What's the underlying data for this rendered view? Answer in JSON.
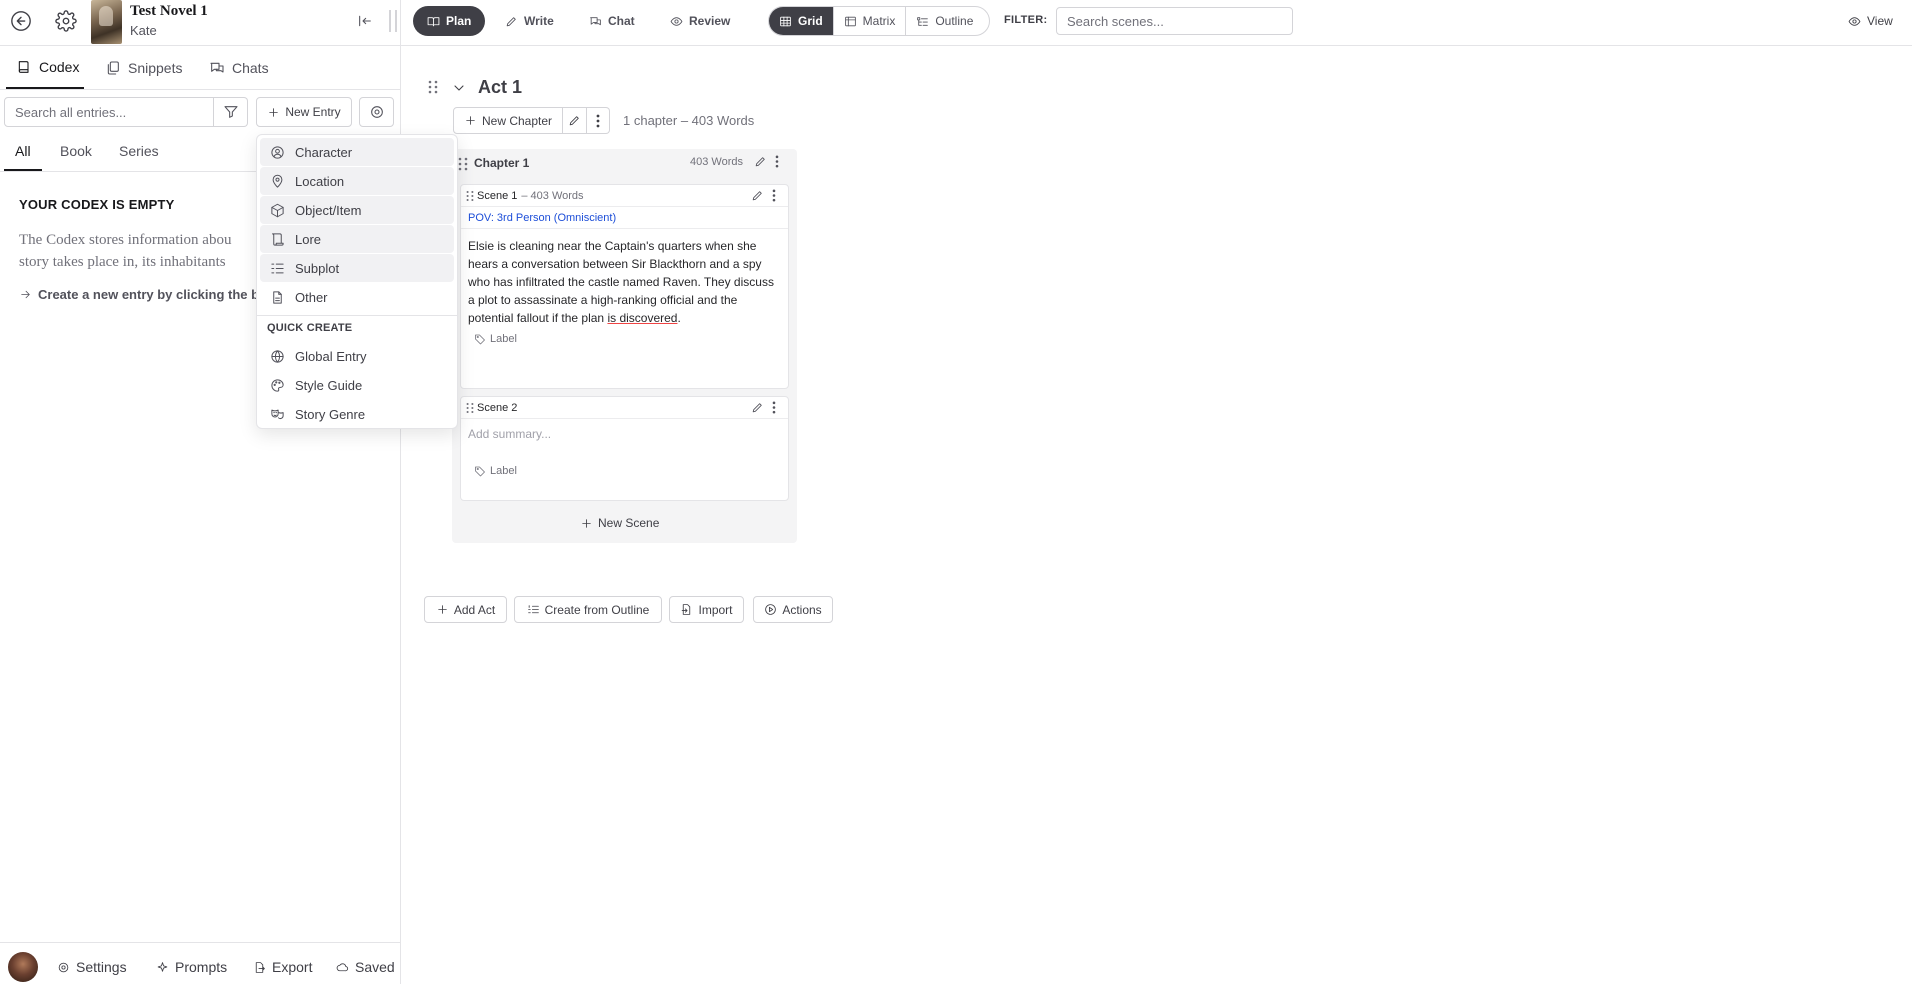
{
  "sidebar": {
    "novel_title": "Test Novel 1",
    "novel_author": "Kate",
    "tabs": [
      {
        "label": "Codex",
        "icon": "book-icon"
      },
      {
        "label": "Snippets",
        "icon": "snippets-icon"
      },
      {
        "label": "Chats",
        "icon": "chats-icon"
      }
    ],
    "search_placeholder": "Search all entries...",
    "new_entry_label": "New Entry",
    "scope_tabs": [
      "All",
      "Book",
      "Series"
    ],
    "empty_title": "YOUR CODEX IS EMPTY",
    "empty_desc": "The Codex stores information abou\nstory takes place in, its inhabitants",
    "empty_hint": "Create a new entry by clicking the bu",
    "footer": {
      "settings": "Settings",
      "prompts": "Prompts",
      "export": "Export",
      "saved": "Saved"
    }
  },
  "dropdown": {
    "items": [
      {
        "label": "Character",
        "icon": "character-icon"
      },
      {
        "label": "Location",
        "icon": "location-pin-icon"
      },
      {
        "label": "Object/Item",
        "icon": "box-icon"
      },
      {
        "label": "Lore",
        "icon": "scroll-icon"
      },
      {
        "label": "Subplot",
        "icon": "subplot-icon"
      },
      {
        "label": "Other",
        "icon": "document-icon"
      }
    ],
    "quick_create_label": "QUICK CREATE",
    "quick_items": [
      {
        "label": "Global Entry",
        "icon": "globe-icon"
      },
      {
        "label": "Style Guide",
        "icon": "palette-icon"
      },
      {
        "label": "Story Genre",
        "icon": "masks-icon"
      }
    ]
  },
  "topbar": {
    "modes": [
      {
        "label": "Plan",
        "active": true
      },
      {
        "label": "Write",
        "active": false
      },
      {
        "label": "Chat",
        "active": false
      },
      {
        "label": "Review",
        "active": false
      }
    ],
    "views": [
      {
        "label": "Grid",
        "active": true
      },
      {
        "label": "Matrix",
        "active": false
      },
      {
        "label": "Outline",
        "active": false
      }
    ],
    "filter_label": "FILTER:",
    "scene_search_placeholder": "Search scenes...",
    "view_menu_label": "View"
  },
  "act": {
    "title": "Act 1",
    "new_chapter_label": "New Chapter",
    "meta": "1 chapter  –  403 Words",
    "chapter": {
      "title": "Chapter 1",
      "words": "403 Words",
      "scenes": [
        {
          "title": "Scene 1",
          "words": "–  403 Words",
          "pov": "POV: 3rd Person (Omniscient)",
          "summary_main": "Elsie is cleaning near the Captain's quarters when she hears a conversation between Sir Blackthorn and a spy who has infiltrated the castle named Raven. They discuss a plot to assassinate a high-ranking official and the potential fallout if the plan ",
          "summary_underlined": "is discovered",
          "summary_end": ".",
          "label": "Label"
        },
        {
          "title": "Scene 2",
          "summary_placeholder": "Add summary...",
          "label": "Label"
        }
      ],
      "new_scene_label": "New Scene"
    }
  },
  "bottom_actions": {
    "add_act": "Add Act",
    "create_from_outline": "Create from Outline",
    "import": "Import",
    "actions": "Actions"
  },
  "colors": {
    "active_dark": "#3f3f46",
    "pov_blue": "#1d4ed8",
    "border": "#d4d4d8",
    "chapter_bg": "#f4f4f5"
  }
}
